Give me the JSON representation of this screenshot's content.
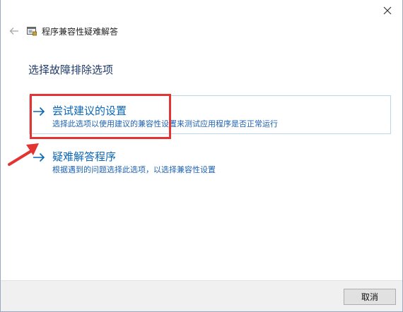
{
  "window": {
    "title": "程序兼容性疑难解答"
  },
  "page": {
    "title": "选择故障排除选项"
  },
  "options": [
    {
      "title": "尝试建议的设置",
      "description": "选择此选项以使用建议的兼容性设置来测试应用程序是否正常运行"
    },
    {
      "title": "疑难解答程序",
      "description": "根据遇到的问题选择此选项，以选择兼容性设置"
    }
  ],
  "footer": {
    "cancel_label": "取消"
  },
  "icons": {
    "close": "close-icon",
    "back": "back-arrow-icon",
    "app": "troubleshooter-icon",
    "option": "arrow-right-icon"
  },
  "colors": {
    "accent": "#0a66b8",
    "option_border": "#b8d7ee",
    "annotation": "#e33434",
    "footer_bg": "#f0f0f0"
  }
}
